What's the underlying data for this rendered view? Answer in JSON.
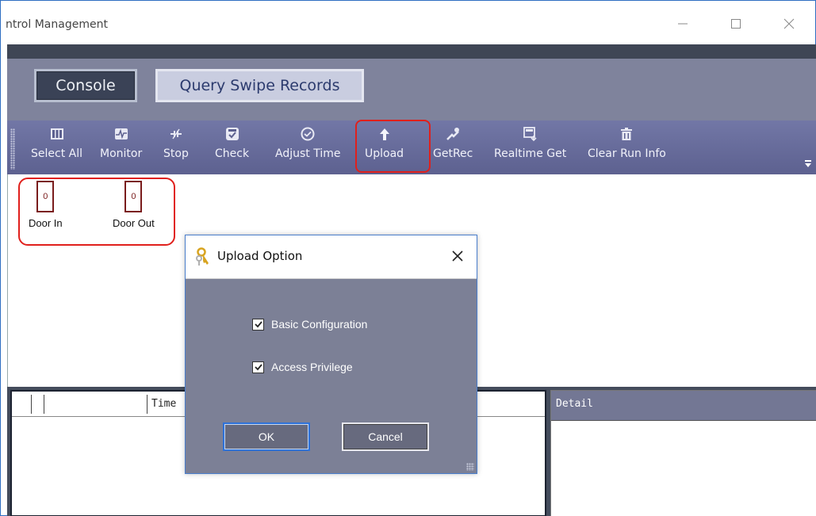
{
  "window": {
    "title": "ntrol Management"
  },
  "tabs": [
    {
      "label": "Console"
    },
    {
      "label": "Query Swipe Records"
    }
  ],
  "toolbar": {
    "items": [
      {
        "label": "Select All",
        "icon": "select-all-icon"
      },
      {
        "label": "Monitor",
        "icon": "monitor-icon"
      },
      {
        "label": "Stop",
        "icon": "stop-icon"
      },
      {
        "label": "Check",
        "icon": "check-icon"
      },
      {
        "label": "Adjust Time",
        "icon": "clock-icon"
      },
      {
        "label": "Upload",
        "icon": "upload-arrow-icon"
      },
      {
        "label": "GetRec",
        "icon": "get-records-icon"
      },
      {
        "label": "Realtime Get",
        "icon": "realtime-get-icon"
      },
      {
        "label": "Clear Run Info",
        "icon": "trash-icon"
      }
    ]
  },
  "doors": [
    {
      "label": "Door In",
      "count": "0"
    },
    {
      "label": "Door Out",
      "count": "0"
    }
  ],
  "log_table": {
    "columns": [
      "Time"
    ]
  },
  "detail_panel": {
    "header": "Detail"
  },
  "dialog": {
    "title": "Upload Option",
    "options": [
      {
        "label": "Basic Configuration",
        "checked": true
      },
      {
        "label": "Access Privilege",
        "checked": true
      }
    ],
    "ok_label": "OK",
    "cancel_label": "Cancel"
  },
  "colors": {
    "toolbar": "#6b6f9e",
    "tab_area": "#7f839c",
    "dialog_body": "#7c8096",
    "highlight": "#e0201c",
    "door_border": "#7a1c1c"
  }
}
